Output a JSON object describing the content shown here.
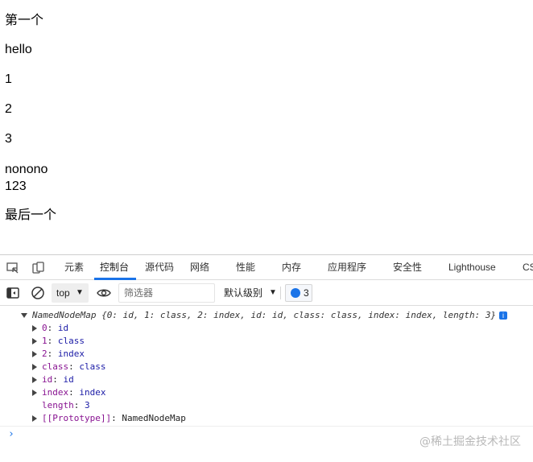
{
  "page": {
    "lines": [
      "第一个",
      "hello",
      "1",
      "2",
      "3",
      "nonono\n123",
      "最后一个"
    ]
  },
  "devtools": {
    "tabs": [
      {
        "label": "元素",
        "active": false
      },
      {
        "label": "控制台",
        "active": true
      },
      {
        "label": "源代码",
        "active": false
      },
      {
        "label": "网络",
        "active": false
      },
      {
        "label": "性能",
        "active": false
      },
      {
        "label": "内存",
        "active": false
      },
      {
        "label": "应用程序",
        "active": false
      },
      {
        "label": "安全性",
        "active": false
      },
      {
        "label": "Lighthouse",
        "active": false
      },
      {
        "label": "CS",
        "active": false
      }
    ],
    "toolbar": {
      "context": "top",
      "filter_placeholder": "筛选器",
      "levels": "默认级别",
      "issues_count": "3"
    },
    "console": {
      "summary": "NamedNodeMap {0: id, 1: class, 2: index, id: id, class: class, index: index, length: 3}",
      "info_badge": "i",
      "entries": [
        {
          "key": "0",
          "value": "id",
          "expandable": true
        },
        {
          "key": "1",
          "value": "class",
          "expandable": true
        },
        {
          "key": "2",
          "value": "index",
          "expandable": true
        },
        {
          "key": "class",
          "value": "class",
          "expandable": true
        },
        {
          "key": "id",
          "value": "id",
          "expandable": true
        },
        {
          "key": "index",
          "value": "index",
          "expandable": true
        },
        {
          "key": "length",
          "value": "3",
          "expandable": false
        },
        {
          "key": "[[Prototype]]",
          "value": "NamedNodeMap",
          "expandable": true
        }
      ],
      "prompt": "›"
    }
  },
  "watermark": "@稀土掘金技术社区",
  "colors": {
    "accent": "#1a73e8",
    "property_key": "#881391",
    "property_value": "#1a1aa6"
  }
}
